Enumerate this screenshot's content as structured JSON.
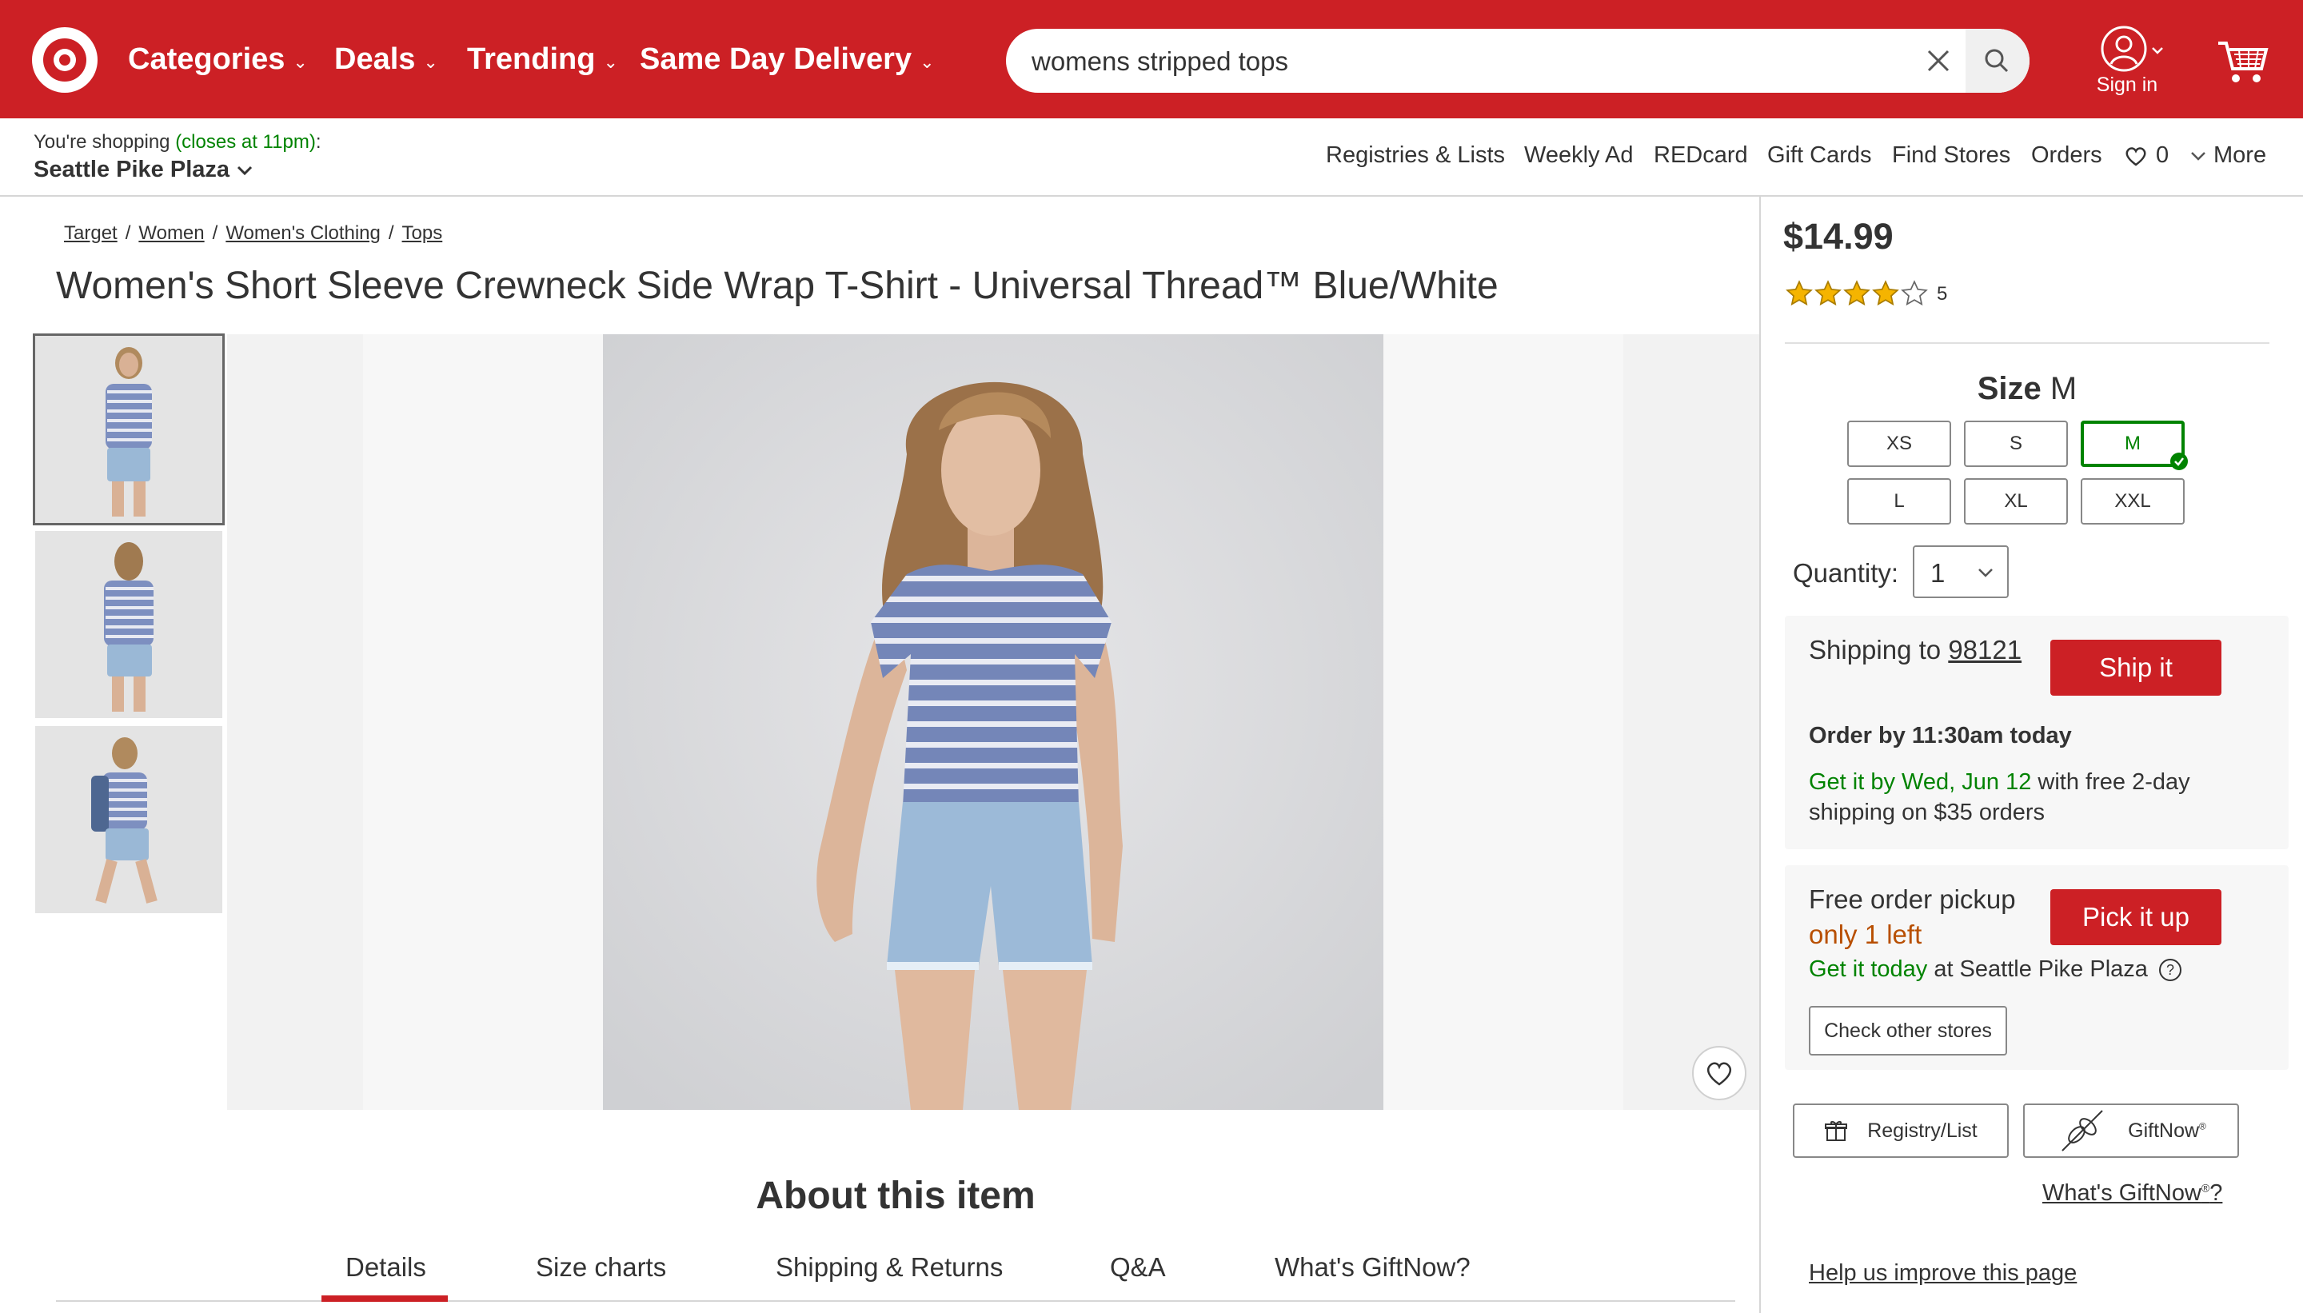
{
  "header": {
    "nav": [
      "Categories",
      "Deals",
      "Trending",
      "Same Day Delivery"
    ],
    "search_value": "womens stripped tops",
    "sign_in": "Sign in",
    "colors": {
      "brand_red": "#cc2025",
      "green": "#008300",
      "orange": "#b84f00"
    }
  },
  "store": {
    "shopping_prefix": "You're shopping",
    "hours": "(closes at 11pm)",
    "suffix": ":",
    "name": "Seattle Pike Plaza",
    "links": [
      "Registries & Lists",
      "Weekly Ad",
      "REDcard",
      "Gift Cards",
      "Find Stores",
      "Orders"
    ],
    "favorites_count": "0",
    "more": "More"
  },
  "product": {
    "breadcrumbs": [
      "Target",
      "Women",
      "Women's Clothing",
      "Tops"
    ],
    "title": "Women's Short Sleeve Crewneck Side Wrap T-Shirt - Universal Thread™ Blue/White",
    "about_heading": "About this item",
    "tabs": [
      "Details",
      "Size charts",
      "Shipping & Returns",
      "Q&A",
      "What's GiftNow?"
    ],
    "selected_tab": "Details"
  },
  "purchase": {
    "price": "$14.99",
    "rating_stars": 4,
    "rating_count": "5",
    "size_label": "Size",
    "size_selected": "M",
    "sizes": [
      "XS",
      "S",
      "M",
      "L",
      "XL",
      "XXL"
    ],
    "quantity_label": "Quantity:",
    "quantity_value": "1",
    "shipping": {
      "label": "Shipping to",
      "zip": "98121",
      "button": "Ship it",
      "order_by": "Order by 11:30am today",
      "get_it_by": "Get it by Wed, Jun 12",
      "free_shipping_1": "with free 2-day",
      "free_shipping_2": "shipping on $35 orders"
    },
    "pickup": {
      "label": "Free order pickup",
      "stock": "only 1 left",
      "button": "Pick it up",
      "get_it_today": "Get it today",
      "at_store": "at Seattle Pike Plaza",
      "check_stores": "Check other stores"
    },
    "registry": "Registry/List",
    "giftnow": "GiftNow",
    "giftnow_mark": "®",
    "whats_giftnow": "What's GiftNow",
    "whats_giftnow_mark": "®",
    "whats_giftnow_q": "?",
    "improve": "Help us improve this page"
  }
}
